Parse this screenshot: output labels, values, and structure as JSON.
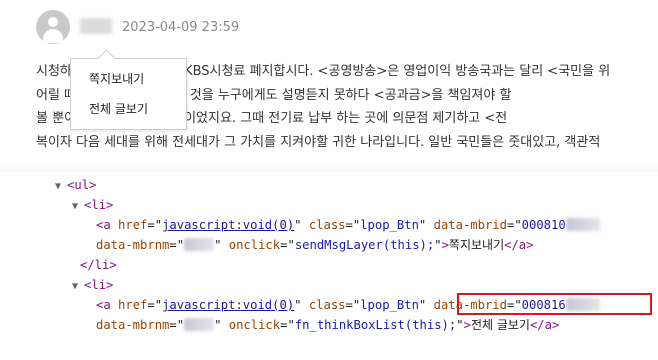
{
  "post": {
    "date": "2023-04-09 23:59",
    "lines": [
      "시청하     나쁜 말이지만 저는 KBS시청료 폐지합시다. <공영방송>은 영업이익 방송국과는 달리 <국민을 위",
      "어릴 때                    KBS만 시청료 내는 것을 누구에게도 설명듣지 못하다 <공과금>을 책임져야 할",
      "볼 뿐이                   신료가 없었기 때문이었지요. 그때 전기료 납부 하는 곳에 의문점 제기하고 <전",
      "복이자 다음 세대를 위해 전세대가 그 가치를 지켜야할 귀한 나라입니다. 일반 국민들은 줏대있고, 객관적"
    ]
  },
  "popup_menu": {
    "items": [
      "쪽지보내기",
      "전체 글보기"
    ]
  },
  "devtools": {
    "ul_tag": "<ul>",
    "li_open": "<li>",
    "li_close": "</li>",
    "a_open": "<a",
    "attr_href": "href",
    "href_value": "javascript:void(0)",
    "attr_class": "class",
    "class_value": "lpop_Btn",
    "attr_mbrid": "data-mbrid",
    "mbrid_value_1": "000810",
    "mbrid_value_2": "000816",
    "attr_mbrnm": "data-mbrnm",
    "attr_onclick": "onclick",
    "onclick_1": "sendMsgLayer(this);",
    "onclick_2": "fn_thinkBoxList(this);",
    "link_text_1": "쪽지보내기",
    "link_text_2": "전체 글보기",
    "a_close": "</a>"
  },
  "colors": {
    "tag": "#881280",
    "attr_name": "#994500",
    "attr_value": "#1a1aa6",
    "highlight": "#d9161c"
  }
}
